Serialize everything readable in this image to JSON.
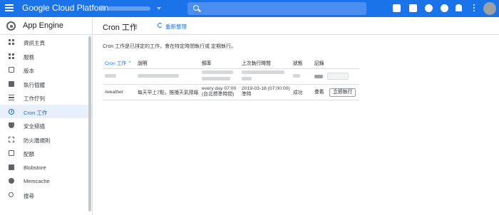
{
  "topbar": {
    "brand": "Google Cloud Platform",
    "icons": [
      "menu-icon",
      "gift-icon",
      "terminal-icon",
      "chat-alert-icon",
      "help-icon",
      "notifications-icon",
      "more-vert-icon",
      "avatar"
    ]
  },
  "sidebar": {
    "app_title": "App Engine",
    "items": [
      {
        "label": "資訊主頁",
        "icon": "dashboard-icon"
      },
      {
        "label": "服務",
        "icon": "services-icon"
      },
      {
        "label": "版本",
        "icon": "versions-icon"
      },
      {
        "label": "執行個體",
        "icon": "instances-icon"
      },
      {
        "label": "工作佇列",
        "icon": "task-queue-icon"
      },
      {
        "label": "Cron 工作",
        "icon": "clock-icon",
        "active": true
      },
      {
        "label": "安全掃描",
        "icon": "shield-icon"
      },
      {
        "label": "防火牆規則",
        "icon": "firewall-icon"
      },
      {
        "label": "配額",
        "icon": "quota-icon"
      },
      {
        "label": "Blobstore",
        "icon": "blobstore-icon"
      },
      {
        "label": "Memcache",
        "icon": "memcache-icon"
      },
      {
        "label": "搜尋",
        "icon": "search-icon"
      }
    ]
  },
  "main": {
    "title": "Cron 工作",
    "refresh_label": "重新整理",
    "description": "Cron 工作是已排定的工作，會在特定時間執行或 定期執行。",
    "table": {
      "headers": [
        "Cron 工作",
        "說明",
        "頻率",
        "上次執行時間",
        "狀態",
        "記錄"
      ],
      "rows": [
        {
          "cron": "/weather",
          "desc": "每天早上7點，推播天氣預報",
          "freq_line1": "every day 07:00",
          "freq_line2": "(台北標準時間)",
          "last_line1": "2019-03-18 (07:00:00)",
          "last_line2": "準時",
          "status": "成功",
          "log": "查看",
          "action": "立即執行"
        }
      ]
    }
  },
  "colors": {
    "topbar": "#1a73e8",
    "active_nav_bg": "#e8f0fe",
    "accent": "#1a73e8"
  }
}
